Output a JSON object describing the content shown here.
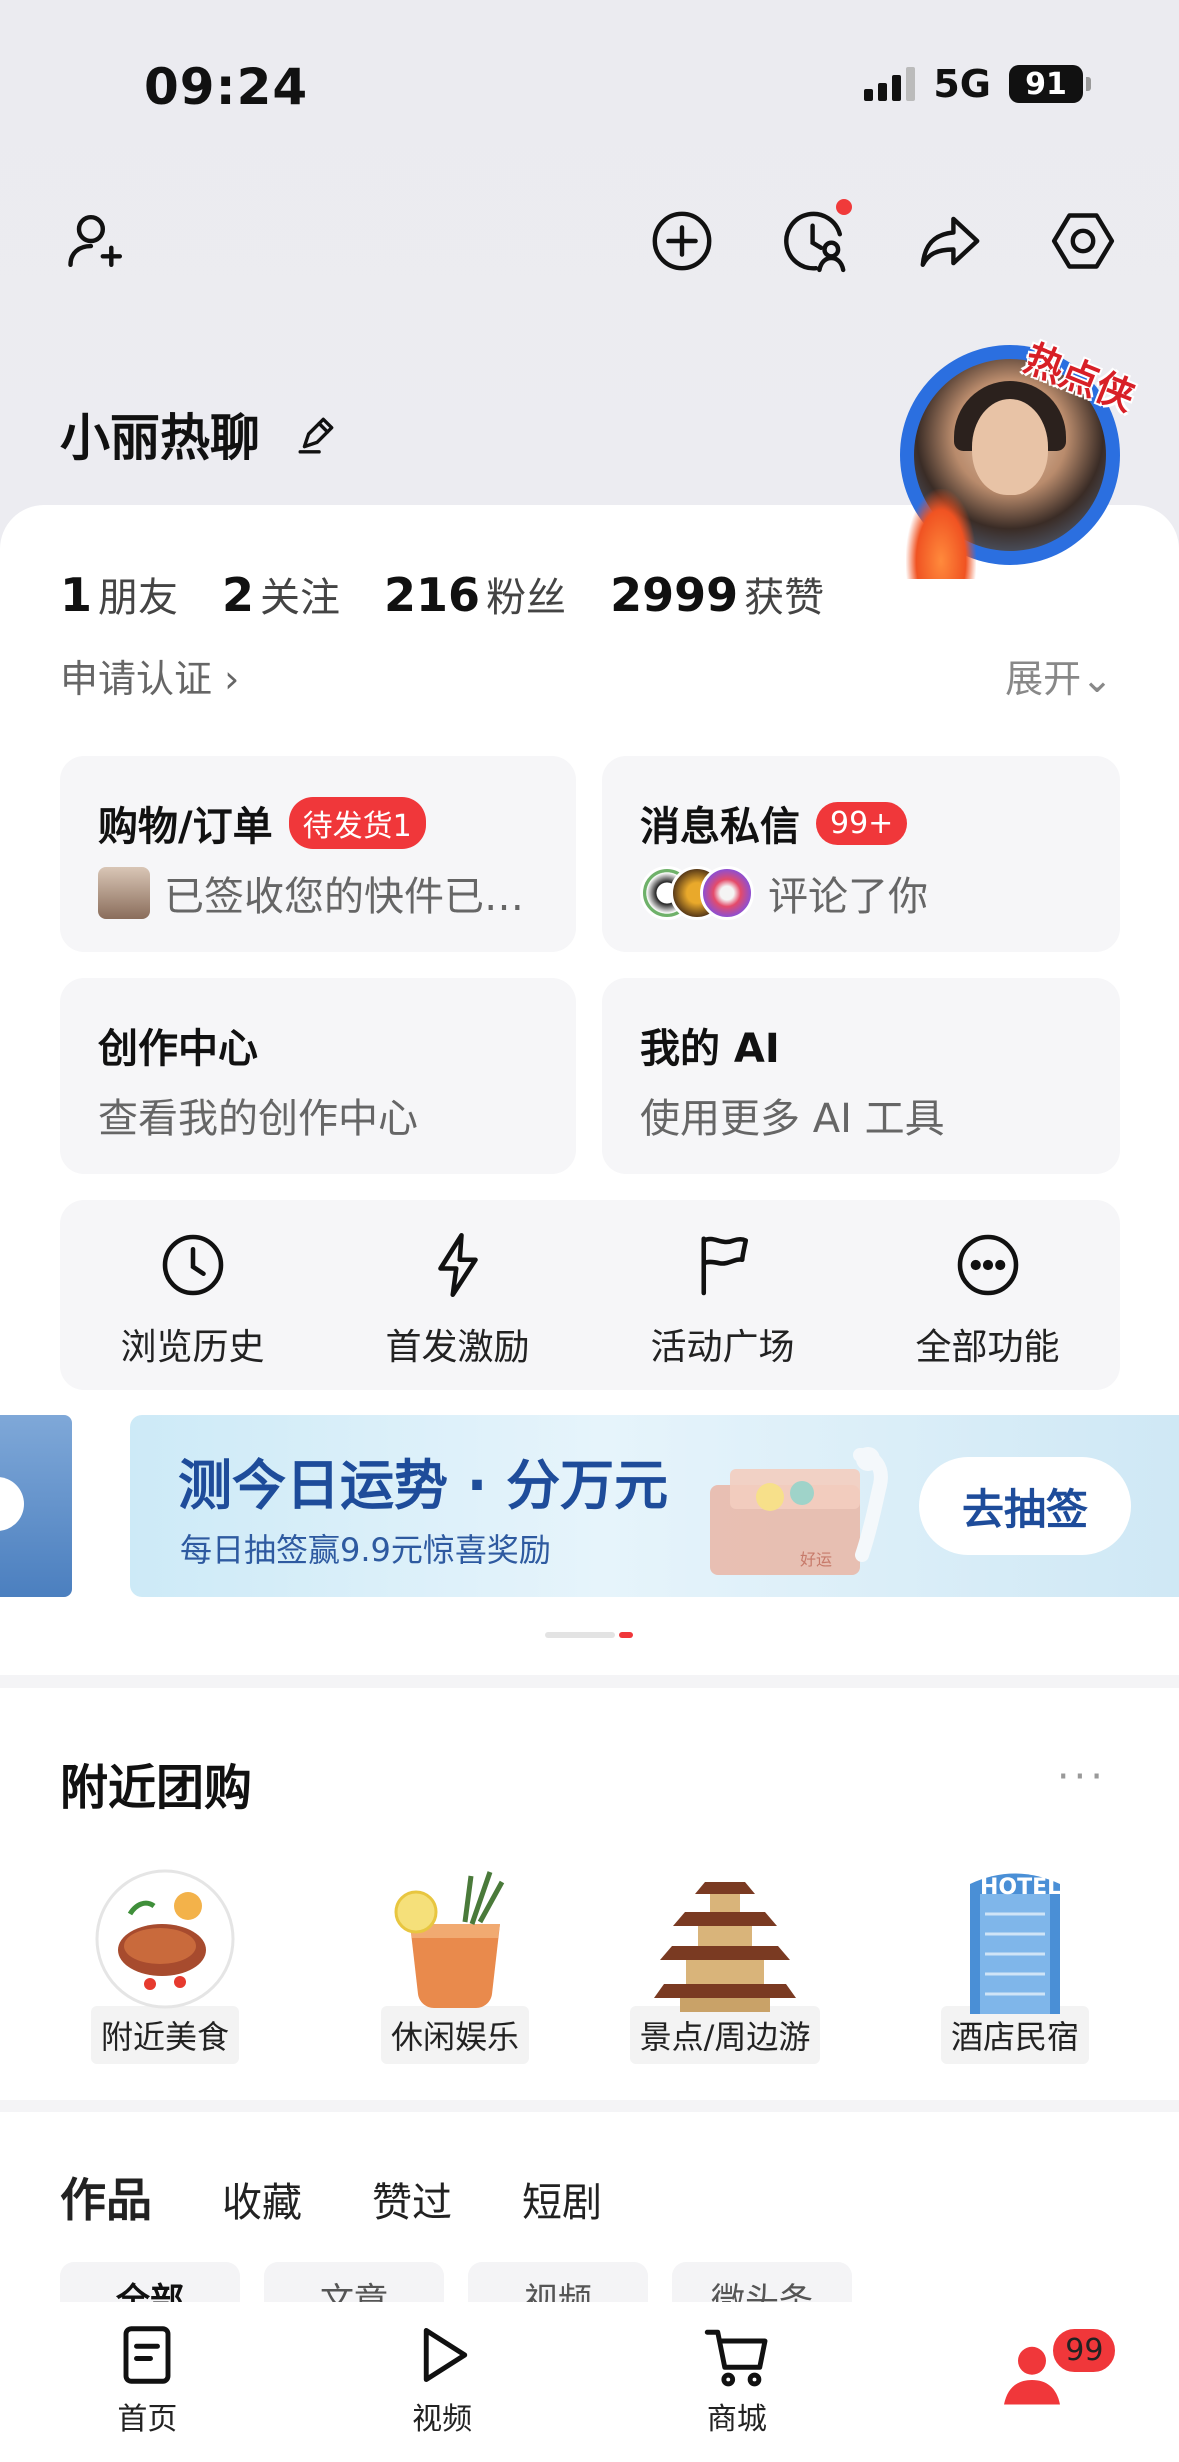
{
  "status": {
    "time": "09:24",
    "network": "5G",
    "battery": "91"
  },
  "profile": {
    "nickname": "小丽热聊",
    "avatar_tag": "热点侠"
  },
  "stats": [
    {
      "num": "1",
      "label": "朋友"
    },
    {
      "num": "2",
      "label": "关注"
    },
    {
      "num": "216",
      "label": "粉丝"
    },
    {
      "num": "2999",
      "label": "获赞"
    }
  ],
  "apply_label": "申请认证 ›",
  "expand_label": "展开⌄",
  "tiles": {
    "shopping": {
      "title": "购物/订单",
      "badge": "待发货1",
      "sub": "已签收您的快件已…"
    },
    "messages": {
      "title": "消息私信",
      "badge": "99+",
      "sub": "评论了你"
    },
    "creator": {
      "title": "创作中心",
      "sub": "查看我的创作中心"
    },
    "ai": {
      "title": "我的 AI",
      "sub": "使用更多 AI 工具"
    }
  },
  "quick": [
    "浏览历史",
    "首发激励",
    "活动广场",
    "全部功能"
  ],
  "banner": {
    "title": "测今日运势 · 分万元",
    "sub": "每日抽签赢9.9元惊喜奖励",
    "button": "去抽签",
    "deco_text": "好运"
  },
  "nearby": {
    "title": "附近团购",
    "more": "···",
    "items": [
      "附近美食",
      "休闲娱乐",
      "景点/周边游",
      "酒店民宿"
    ],
    "hotel_sign": "HOTEL"
  },
  "works": {
    "tabs": [
      "作品",
      "收藏",
      "赞过",
      "短剧"
    ],
    "chips": [
      "全部",
      "文章",
      "视频",
      "微头条"
    ]
  },
  "bottom_nav": [
    "首页",
    "视频",
    "商城"
  ],
  "me_badge": "99",
  "colors": {
    "accent": "#f0373a",
    "banner_blue": "#1e4c9a"
  }
}
